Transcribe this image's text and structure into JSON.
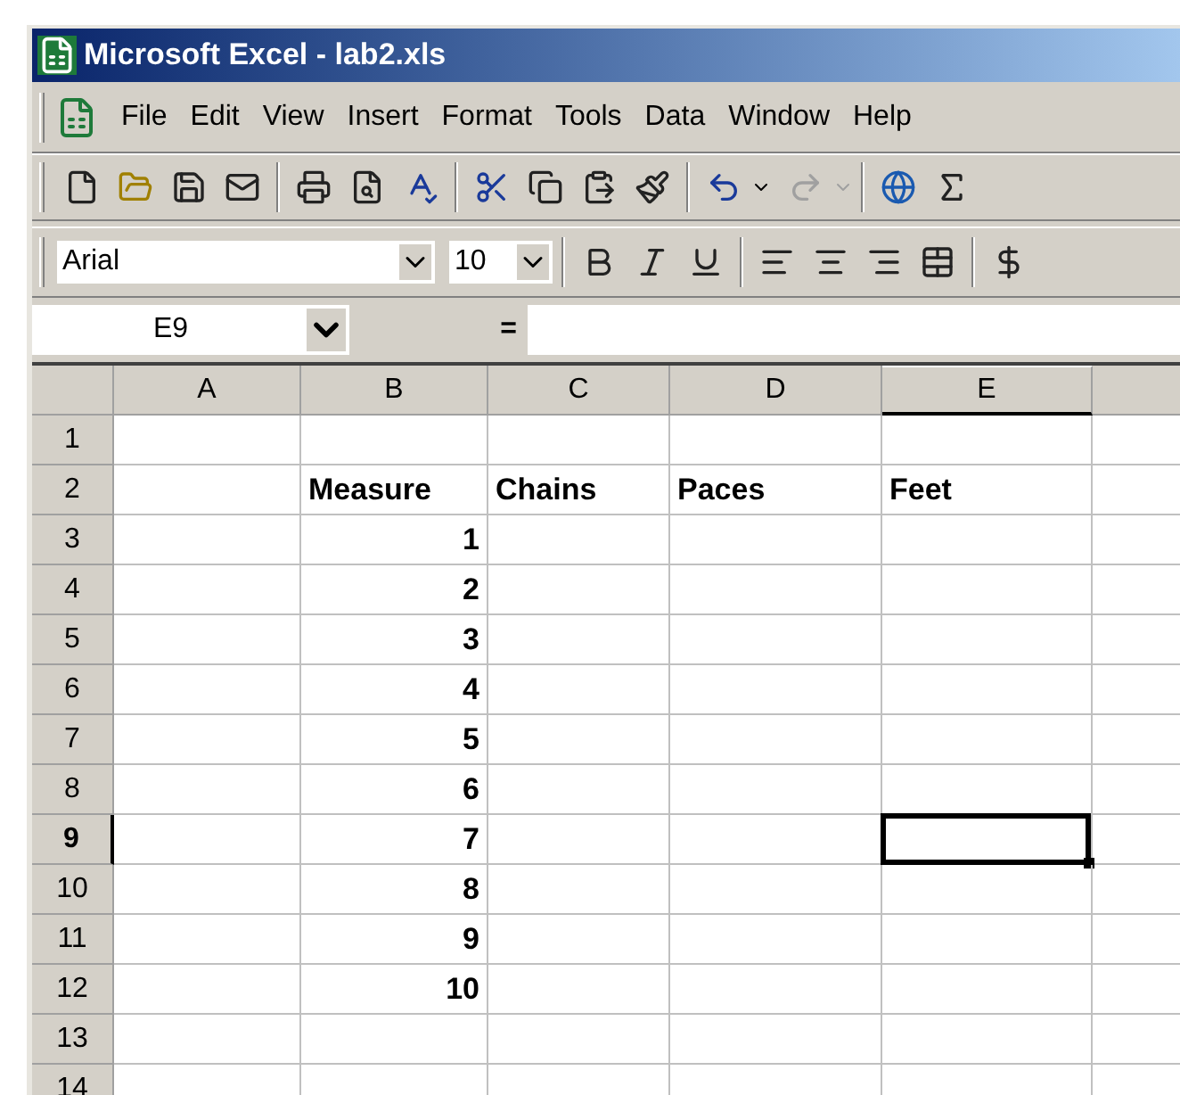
{
  "window": {
    "title": "Microsoft Excel - lab2.xls"
  },
  "menu": [
    "File",
    "Edit",
    "View",
    "Insert",
    "Format",
    "Tools",
    "Data",
    "Window",
    "Help"
  ],
  "format_bar": {
    "font": "Arial",
    "size": "10"
  },
  "formula_bar": {
    "name_box": "E9",
    "equals": "="
  },
  "columns": [
    {
      "label": "A",
      "selected": false
    },
    {
      "label": "B",
      "selected": false
    },
    {
      "label": "C",
      "selected": false
    },
    {
      "label": "D",
      "selected": false
    },
    {
      "label": "E",
      "selected": true
    }
  ],
  "rows": [
    {
      "label": "1",
      "selected": false,
      "kind": "blank"
    },
    {
      "label": "2",
      "selected": false,
      "kind": "labels",
      "cells": {
        "B": "Measure",
        "C": "Chains",
        "D": "Paces",
        "E": "Feet"
      }
    },
    {
      "label": "3",
      "selected": false,
      "kind": "values",
      "cells": {
        "B": "1"
      }
    },
    {
      "label": "4",
      "selected": false,
      "kind": "values",
      "cells": {
        "B": "2"
      }
    },
    {
      "label": "5",
      "selected": false,
      "kind": "values",
      "cells": {
        "B": "3"
      }
    },
    {
      "label": "6",
      "selected": false,
      "kind": "values",
      "cells": {
        "B": "4"
      }
    },
    {
      "label": "7",
      "selected": false,
      "kind": "values",
      "cells": {
        "B": "5"
      }
    },
    {
      "label": "8",
      "selected": false,
      "kind": "values",
      "cells": {
        "B": "6"
      }
    },
    {
      "label": "9",
      "selected": true,
      "kind": "values",
      "cells": {
        "B": "7"
      }
    },
    {
      "label": "10",
      "selected": false,
      "kind": "values",
      "cells": {
        "B": "8"
      }
    },
    {
      "label": "11",
      "selected": false,
      "kind": "values",
      "cells": {
        "B": "9"
      }
    },
    {
      "label": "12",
      "selected": false,
      "kind": "values",
      "cells": {
        "B": "10"
      }
    },
    {
      "label": "13",
      "selected": false,
      "kind": "blank"
    },
    {
      "label": "14",
      "selected": false,
      "kind": "blank"
    }
  ]
}
